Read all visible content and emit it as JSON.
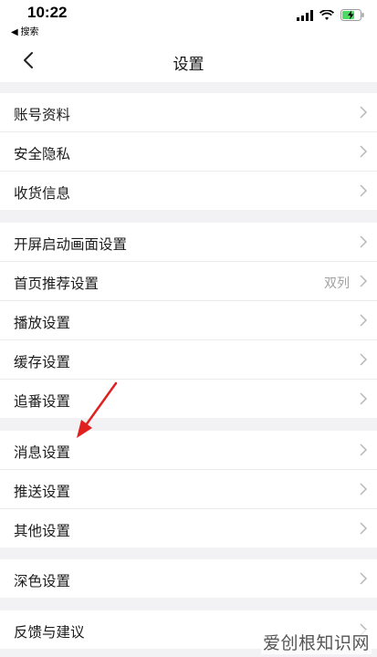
{
  "status_bar": {
    "time": "10:22",
    "back_app": "◀ 搜索",
    "icons": [
      "signal-icon",
      "wifi-icon",
      "battery-charging-icon"
    ]
  },
  "nav": {
    "title": "设置",
    "back_icon": "chevron-left-icon"
  },
  "groups": [
    {
      "items": [
        {
          "label": "账号资料"
        },
        {
          "label": "安全隐私"
        },
        {
          "label": "收货信息"
        }
      ]
    },
    {
      "items": [
        {
          "label": "开屏启动画面设置"
        },
        {
          "label": "首页推荐设置",
          "value": "双列"
        },
        {
          "label": "播放设置"
        },
        {
          "label": "缓存设置"
        },
        {
          "label": "追番设置"
        }
      ]
    },
    {
      "items": [
        {
          "label": "消息设置"
        },
        {
          "label": "推送设置"
        },
        {
          "label": "其他设置"
        }
      ]
    },
    {
      "items": [
        {
          "label": "深色设置"
        }
      ]
    },
    {
      "items": [
        {
          "label": "反馈与建议"
        }
      ]
    }
  ],
  "annotation": {
    "color": "#e02020"
  },
  "watermark": "爱创根知识网"
}
